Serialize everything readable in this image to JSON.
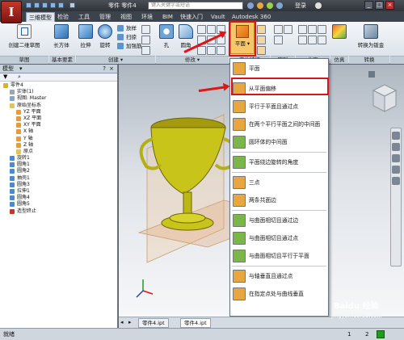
{
  "titlebar": {
    "app_letter": "I",
    "doc_title": "零件 零件4",
    "search_placeholder": "键入关键字或短语",
    "login": "登录",
    "vault": "Vault",
    "autodesk": "Autodesk 360"
  },
  "tabs": [
    "三维模型",
    "检验",
    "工具",
    "管理",
    "视图",
    "环境",
    "BIM",
    "快速入门",
    "Vault",
    "Autodesk 360"
  ],
  "ribbon": {
    "create_sketch": "创建二维草图",
    "extrude": "长方体",
    "stretch": "拉伸",
    "revolve": "旋转",
    "sweep": "放样",
    "loft": "扫掠",
    "rib": "加强筋",
    "hole": "孔",
    "fillet": "圆角",
    "plane": "平面",
    "convert": "转换为钣金",
    "groups": {
      "sketch": "草图",
      "primitives": "基本要素",
      "create": "创建 ▾",
      "modify": "修改 ▾",
      "work": "定位特征",
      "pattern": "阵列",
      "surface": "曲面",
      "simulation": "仿真",
      "convert": "转换"
    }
  },
  "browser": {
    "title": "模型",
    "rows": [
      {
        "label": "零件4",
        "indent": 0,
        "color": "#d4b13a"
      },
      {
        "label": "实体(1)",
        "indent": 1,
        "color": "#9aa6b2"
      },
      {
        "label": "视图: Master",
        "indent": 1,
        "color": "#7fa6d0"
      },
      {
        "label": "原始坐标系",
        "indent": 1,
        "color": "#e6c35a"
      },
      {
        "label": "YZ 平面",
        "indent": 2,
        "color": "#e89a3c"
      },
      {
        "label": "XZ 平面",
        "indent": 2,
        "color": "#e89a3c"
      },
      {
        "label": "XY 平面",
        "indent": 2,
        "color": "#e89a3c"
      },
      {
        "label": "X 轴",
        "indent": 2,
        "color": "#e89a3c"
      },
      {
        "label": "Y 轴",
        "indent": 2,
        "color": "#e89a3c"
      },
      {
        "label": "Z 轴",
        "indent": 2,
        "color": "#e89a3c"
      },
      {
        "label": "原点",
        "indent": 2,
        "color": "#e6c35a"
      },
      {
        "label": "旋转1",
        "indent": 1,
        "color": "#4a8ad0"
      },
      {
        "label": "圆角1",
        "indent": 1,
        "color": "#4a8ad0"
      },
      {
        "label": "圆角2",
        "indent": 1,
        "color": "#4a8ad0"
      },
      {
        "label": "抽壳1",
        "indent": 1,
        "color": "#4a8ad0"
      },
      {
        "label": "圆角3",
        "indent": 1,
        "color": "#4a8ad0"
      },
      {
        "label": "拉伸1",
        "indent": 1,
        "color": "#4a8ad0"
      },
      {
        "label": "圆角4",
        "indent": 1,
        "color": "#4a8ad0"
      },
      {
        "label": "圆角5",
        "indent": 1,
        "color": "#4a8ad0"
      },
      {
        "label": "造型终止",
        "indent": 1,
        "color": "#c0392b"
      }
    ]
  },
  "dropdown": {
    "items": [
      {
        "label": "平面",
        "color": "#e8a640"
      },
      {
        "label": "从平面偏移",
        "color": "#e8a640"
      },
      {
        "label": "平行于平面且通过点",
        "color": "#e8a640"
      },
      {
        "label": "在两个平行平面之间的中间面",
        "color": "#e8a640"
      },
      {
        "label": "圆环体的中间面",
        "color": "#7ab648"
      },
      {
        "label": "平面绕边旋转的角度",
        "color": "#7ab648"
      },
      {
        "label": "三点",
        "color": "#e8a640"
      },
      {
        "label": "两条共面边",
        "color": "#e8a640"
      },
      {
        "label": "与曲面相切且通过边",
        "color": "#7ab648"
      },
      {
        "label": "与曲面相切且通过点",
        "color": "#7ab648"
      },
      {
        "label": "与曲面相切且平行于平面",
        "color": "#7ab648"
      },
      {
        "label": "与轴垂直且通过点",
        "color": "#e8a640"
      },
      {
        "label": "在指定点处与曲线垂直",
        "color": "#e8a640"
      }
    ]
  },
  "doc_tabs": [
    "零件4.ipt",
    "零件4.ipt"
  ],
  "status": {
    "ready": "就绪",
    "count1": "1",
    "count2": "2"
  },
  "watermark": "Baidu 经验",
  "watermark_url": "jingyan.baidu.com",
  "colors": {
    "accent_red": "#d9141b",
    "brand_red": "#c0392b",
    "trophy": "#c9c41a"
  }
}
